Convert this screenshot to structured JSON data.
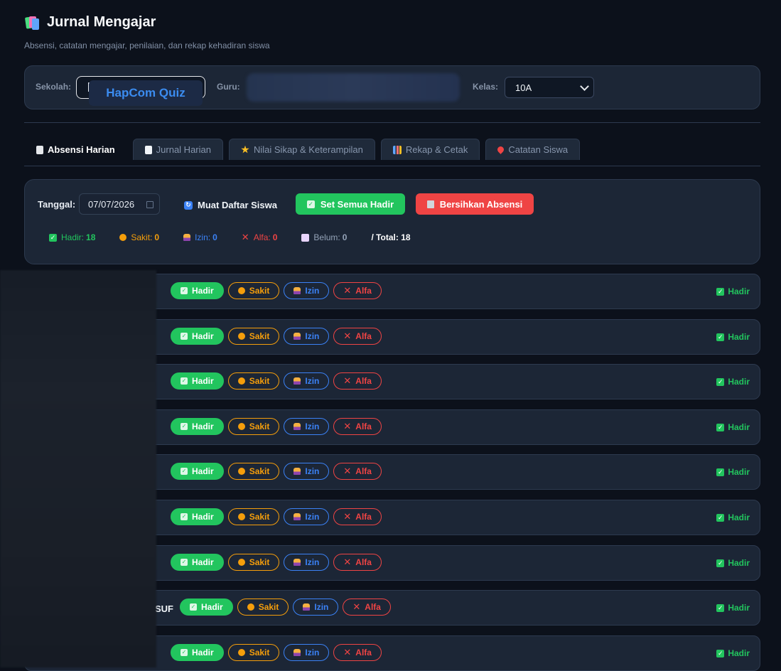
{
  "app": {
    "title": "Jurnal Mengajar",
    "subtitle": "Absensi, catatan mengajar, penilaian, dan rekap kehadiran siswa",
    "brand_badge": "HapCom Quiz"
  },
  "settings": {
    "school_label": "Sekolah:",
    "teacher_label": "Guru:",
    "class_label": "Kelas:",
    "class_value": "10A"
  },
  "tabs": [
    {
      "label": "Absensi Harian",
      "active": true,
      "icon": "clipboard-icon"
    },
    {
      "label": "Jurnal Harian",
      "active": false,
      "icon": "memo-icon"
    },
    {
      "label": "Nilai Sikap & Keterampilan",
      "active": false,
      "icon": "star-icon"
    },
    {
      "label": "Rekap & Cetak",
      "active": false,
      "icon": "bar-chart-icon"
    },
    {
      "label": "Catatan Siswa",
      "active": false,
      "icon": "pushpin-icon"
    }
  ],
  "attendance": {
    "date_label": "Tanggal:",
    "date_value": "07/07/2026",
    "load_label": "Muat Daftar Siswa",
    "set_all_label": "Set Semua Hadir",
    "clear_label": "Bersihkan Absensi",
    "stats": {
      "hadir_label": "Hadir:",
      "hadir": "18",
      "sakit_label": "Sakit:",
      "sakit": "0",
      "izin_label": "Izin:",
      "izin": "0",
      "alfa_label": "Alfa:",
      "alfa": "0",
      "belum_label": "Belum:",
      "belum": "0",
      "total_label": "/ Total: 18"
    }
  },
  "buttons": {
    "hadir": "Hadir",
    "sakit": "Sakit",
    "izin": "Izin",
    "alfa": "Alfa"
  },
  "students": [
    {
      "name": "",
      "status": "Hadir"
    },
    {
      "name": "",
      "status": "Hadir"
    },
    {
      "name": "",
      "status": "Hadir"
    },
    {
      "name": "",
      "status": "Hadir"
    },
    {
      "name": "",
      "status": "Hadir"
    },
    {
      "name": "",
      "status": "Hadir"
    },
    {
      "name": "",
      "status": "Hadir"
    },
    {
      "name": "SUF",
      "status": "Hadir"
    },
    {
      "name": "",
      "status": "Hadir"
    }
  ],
  "colors": {
    "hadir": "#22c55e",
    "sakit": "#f59e0b",
    "izin": "#3b82f6",
    "alfa": "#ef4444"
  }
}
